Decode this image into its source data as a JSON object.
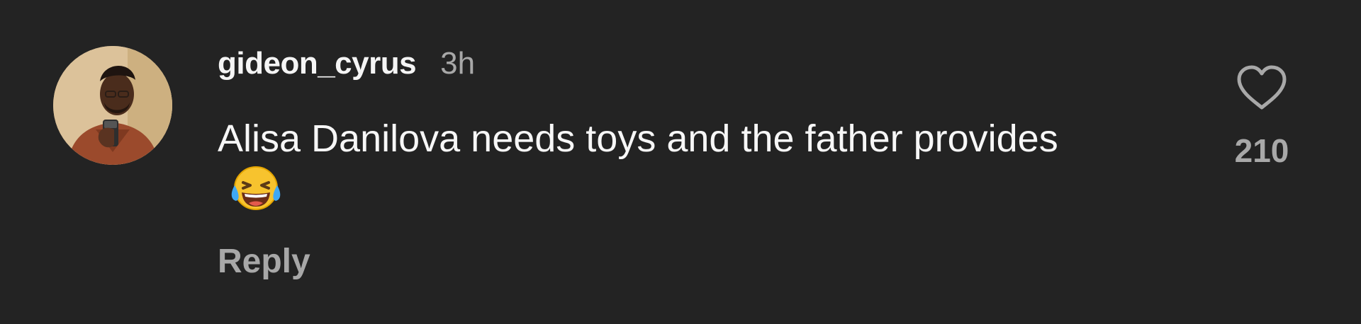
{
  "comment": {
    "username": "gideon_cyrus",
    "timestamp": "3h",
    "text": "Alisa Danilova needs toys and the father provides",
    "emoji": "face-with-tears-of-joy",
    "reply_label": "Reply",
    "like_count": "210"
  },
  "icons": {
    "like": "heart-outline-icon",
    "emoji": "laughing-emoji-icon"
  },
  "colors": {
    "background": "#232323",
    "primary_text": "#f5f5f5",
    "secondary_text": "#a8a8a8"
  }
}
